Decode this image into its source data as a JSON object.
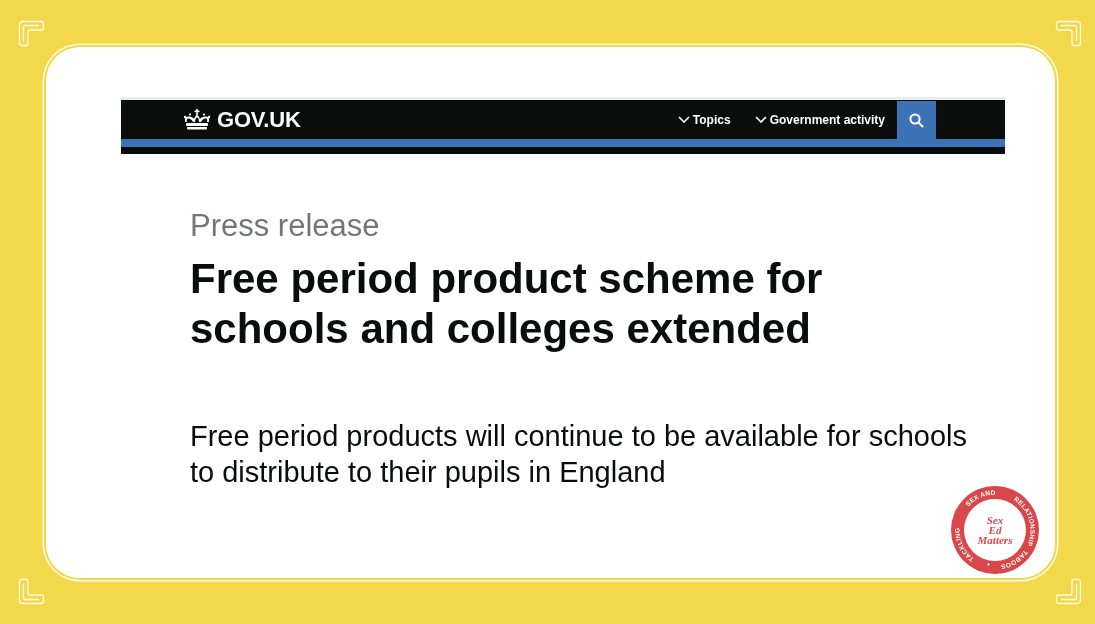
{
  "header": {
    "logo": "GOV.UK",
    "nav": [
      {
        "label": "Topics",
        "expanded": false
      },
      {
        "label": "Government activity",
        "expanded": false
      }
    ]
  },
  "article": {
    "label": "Press release",
    "title": "Free period product scheme for schools and colleges extended",
    "summary": "Free period products will continue to be available for schools to distribute to their pupils in England"
  },
  "stamp": {
    "ring_words": [
      "TACKLING",
      "SEX AND",
      "RELATIONSHIP",
      "TABOOS"
    ],
    "wordmark_lines": [
      "Sex",
      "Ed",
      "Matters"
    ]
  }
}
